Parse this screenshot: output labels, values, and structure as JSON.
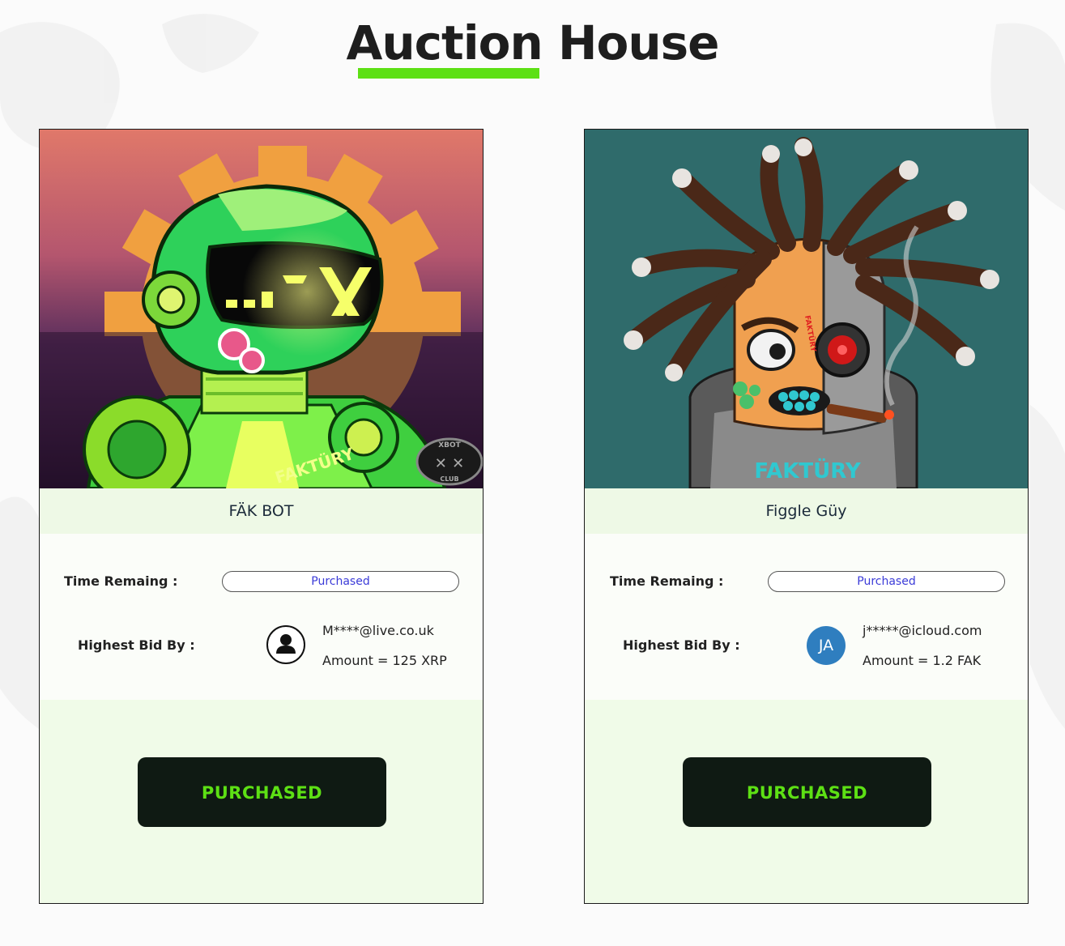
{
  "page": {
    "title_part1": "Auction",
    "title_part2": " House",
    "accent_color": "#5de014"
  },
  "cards": [
    {
      "name": "FÄK BOT",
      "time_label": "Time Remaing :",
      "time_value": "Purchased",
      "bid_label": "Highest Bid By :",
      "bidder_avatar": "user-icon",
      "bidder_email": "M****@live.co.uk",
      "amount": "Amount = 125 XRP",
      "button_label": "PURCHASED",
      "art": {
        "logo_text": "XBOT",
        "logo_text2": "CLUB",
        "brand_text": "FAKTÜRY"
      }
    },
    {
      "name": "Figgle Güy",
      "time_label": "Time Remaing :",
      "time_value": "Purchased",
      "bid_label": "Highest Bid By :",
      "bidder_avatar": "JA",
      "bidder_email": "j*****@icloud.com",
      "amount": "Amount = 1.2 FAK",
      "button_label": "PURCHASED",
      "art": {
        "brand_text": "FAKTÜRY",
        "tattoo_text": "FAKTÜRY"
      }
    }
  ]
}
